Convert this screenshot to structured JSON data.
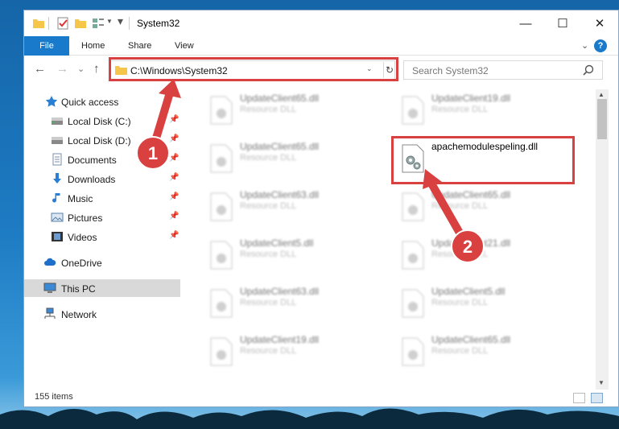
{
  "window": {
    "title": "System32"
  },
  "ribbon": {
    "tabs": [
      "File",
      "Home",
      "Share",
      "View"
    ],
    "help": "?"
  },
  "controls": {
    "minimize": "—",
    "maximize": "☐",
    "close": "✕"
  },
  "nav": {
    "back": "←",
    "forward": "→",
    "recent": "⌄",
    "up": "↑"
  },
  "address": {
    "path": "C:\\Windows\\System32",
    "refresh": "↻",
    "dropdown": "⌄"
  },
  "search": {
    "placeholder": "Search System32"
  },
  "sidebar": {
    "items": [
      {
        "label": "Quick access",
        "icon": "star-icon",
        "pinned": false
      },
      {
        "label": "Local Disk (C:)",
        "icon": "drive-icon",
        "pinned": true
      },
      {
        "label": "Local Disk (D:)",
        "icon": "drive-icon",
        "pinned": true
      },
      {
        "label": "Documents",
        "icon": "documents-icon",
        "pinned": true
      },
      {
        "label": "Downloads",
        "icon": "download-icon",
        "pinned": true
      },
      {
        "label": "Music",
        "icon": "music-icon",
        "pinned": true
      },
      {
        "label": "Pictures",
        "icon": "pictures-icon",
        "pinned": true
      },
      {
        "label": "Videos",
        "icon": "videos-icon",
        "pinned": true
      },
      {
        "label": "OneDrive",
        "icon": "cloud-icon",
        "pinned": false
      },
      {
        "label": "This PC",
        "icon": "computer-icon",
        "pinned": false,
        "selected": true
      },
      {
        "label": "Network",
        "icon": "network-icon",
        "pinned": false
      }
    ]
  },
  "files": {
    "left": [
      {
        "name": "UpdateClient65.dll",
        "type": "Resource DLL"
      },
      {
        "name": "UpdateClient65.dll",
        "type": "Resource DLL"
      },
      {
        "name": "UpdateClient63.dll",
        "type": "Resource DLL"
      },
      {
        "name": "UpdateClient5.dll",
        "type": "Resource DLL"
      },
      {
        "name": "UpdateClient63.dll",
        "type": "Resource DLL"
      },
      {
        "name": "UpdateClient19.dll",
        "type": "Resource DLL"
      }
    ],
    "right": [
      {
        "name": "UpdateClient19.dll",
        "type": "Resource DLL"
      },
      {
        "name": "apachemodulespeling.dll",
        "type": "",
        "highlighted": true
      },
      {
        "name": "UpdateClient65.dll",
        "type": "Resource DLL"
      },
      {
        "name": "UpdateClient21.dll",
        "type": "Resource DLL"
      },
      {
        "name": "UpdateClient5.dll",
        "type": "Resource DLL"
      },
      {
        "name": "UpdateClient65.dll",
        "type": "Resource DLL"
      }
    ]
  },
  "status": {
    "count": "155 items"
  },
  "annotations": {
    "badge1": "1",
    "badge2": "2",
    "color": "#d94040"
  },
  "colors": {
    "accent": "#1979ca",
    "highlight": "#d94040",
    "selected_bg": "#cce4f7"
  }
}
